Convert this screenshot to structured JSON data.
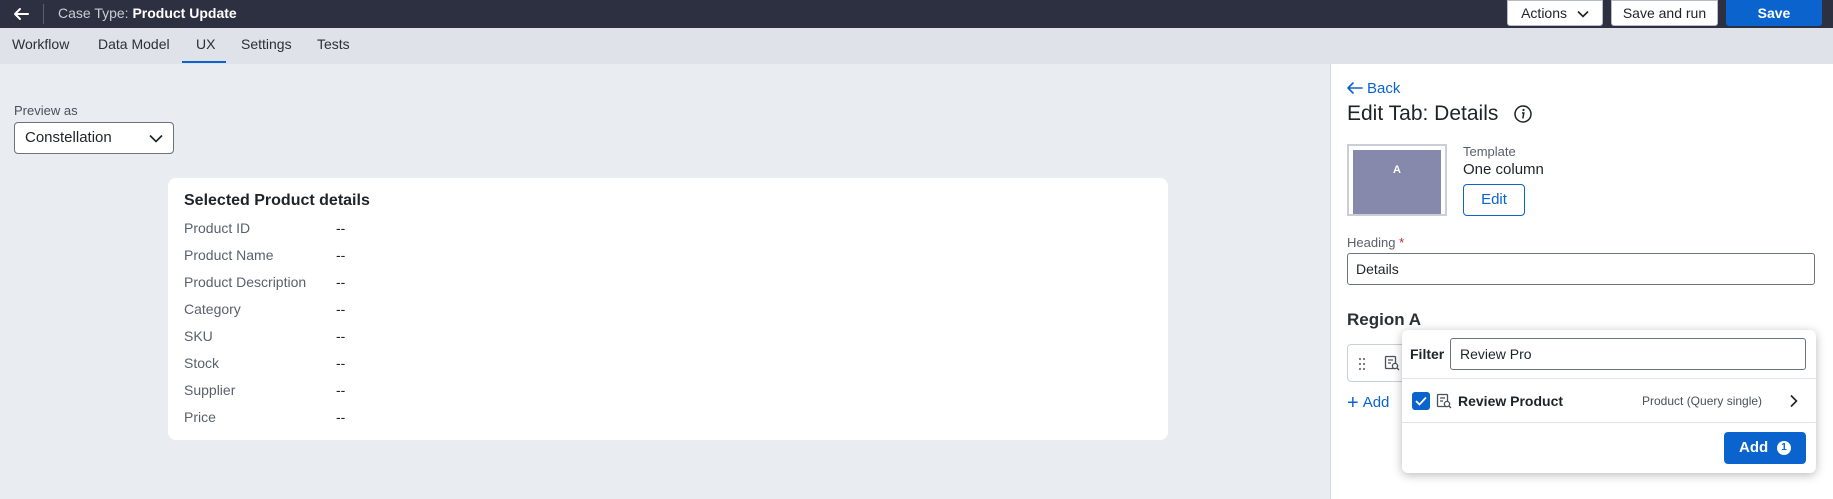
{
  "header": {
    "case_type_prefix": "Case Type:",
    "case_type_name": "Product Update",
    "actions_label": "Actions",
    "save_and_run_label": "Save and run",
    "save_label": "Save"
  },
  "tabs": [
    {
      "label": "Workflow"
    },
    {
      "label": "Data Model"
    },
    {
      "label": "UX",
      "active": true
    },
    {
      "label": "Settings"
    },
    {
      "label": "Tests"
    }
  ],
  "preview": {
    "label": "Preview as",
    "value": "Constellation"
  },
  "card": {
    "title": "Selected Product details",
    "fields": [
      {
        "label": "Product ID",
        "value": "--"
      },
      {
        "label": "Product Name",
        "value": "--"
      },
      {
        "label": "Product Description",
        "value": "--"
      },
      {
        "label": "Category",
        "value": "--"
      },
      {
        "label": "SKU",
        "value": "--"
      },
      {
        "label": "Stock",
        "value": "--"
      },
      {
        "label": "Supplier",
        "value": "--"
      },
      {
        "label": "Price",
        "value": "--"
      }
    ]
  },
  "panel": {
    "back_label": "Back",
    "title": "Edit Tab: Details",
    "thumb_letter": "A",
    "template_label": "Template",
    "template_value": "One column",
    "edit_label": "Edit",
    "heading_label": "Heading",
    "heading_required": "*",
    "heading_value": "Details",
    "region_title": "Region A",
    "add_label": "Add"
  },
  "popover": {
    "filter_label": "Filter",
    "filter_value": "Review Pro",
    "item_name": "Review Product",
    "item_type": "Product (Query single)",
    "item_checked": true,
    "add_label": "Add",
    "add_count": "1"
  },
  "colors": {
    "topbar": "#2c3041",
    "accent": "#0b63ce",
    "background": "#e9edf1",
    "thumb": "#8689ab"
  }
}
